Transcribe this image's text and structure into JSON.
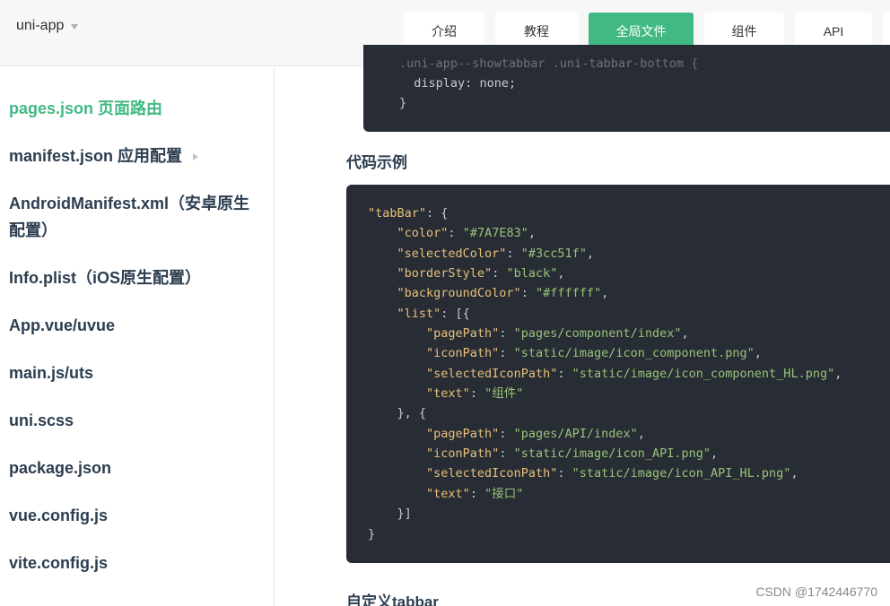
{
  "header": {
    "brand": "uni-app",
    "tabs": [
      {
        "label": "介绍",
        "active": false
      },
      {
        "label": "教程",
        "active": false
      },
      {
        "label": "全局文件",
        "active": true
      },
      {
        "label": "组件",
        "active": false
      },
      {
        "label": "API",
        "active": false
      }
    ]
  },
  "sidebar": {
    "items": [
      {
        "label": "pages.json 页面路由",
        "active": true
      },
      {
        "label": "manifest.json 应用配置",
        "expandable": true
      },
      {
        "label": "AndroidManifest.xml（安卓原生配置）"
      },
      {
        "label": "Info.plist（iOS原生配置）"
      },
      {
        "label": "App.vue/uvue"
      },
      {
        "label": "main.js/uts"
      },
      {
        "label": "uni.scss"
      },
      {
        "label": "package.json"
      },
      {
        "label": "vue.config.js"
      },
      {
        "label": "vite.config.js"
      }
    ]
  },
  "main": {
    "top_code": {
      "partial_line": ".uni-app--showtabbar .uni-tabbar-bottom {",
      "prop": "display",
      "value": "none",
      "close": "}"
    },
    "example_heading": "代码示例",
    "example_code": {
      "tabBar_key": "\"tabBar\"",
      "color_key": "\"color\"",
      "color_val": "\"#7A7E83\"",
      "selectedColor_key": "\"selectedColor\"",
      "selectedColor_val": "\"#3cc51f\"",
      "borderStyle_key": "\"borderStyle\"",
      "borderStyle_val": "\"black\"",
      "backgroundColor_key": "\"backgroundColor\"",
      "backgroundColor_val": "\"#ffffff\"",
      "list_key": "\"list\"",
      "item1": {
        "pagePath_key": "\"pagePath\"",
        "pagePath_val": "\"pages/component/index\"",
        "iconPath_key": "\"iconPath\"",
        "iconPath_val": "\"static/image/icon_component.png\"",
        "selectedIconPath_key": "\"selectedIconPath\"",
        "selectedIconPath_val": "\"static/image/icon_component_HL.png\"",
        "text_key": "\"text\"",
        "text_val": "\"组件\""
      },
      "item2": {
        "pagePath_key": "\"pagePath\"",
        "pagePath_val": "\"pages/API/index\"",
        "iconPath_key": "\"iconPath\"",
        "iconPath_val": "\"static/image/icon_API.png\"",
        "selectedIconPath_key": "\"selectedIconPath\"",
        "selectedIconPath_val": "\"static/image/icon_API_HL.png\"",
        "text_key": "\"text\"",
        "text_val": "\"接口\""
      }
    },
    "next_heading": "自定义tabbar"
  },
  "watermark": "CSDN @1742446770",
  "colors": {
    "accent": "#42b983",
    "code_bg": "#282c34",
    "code_key": "#e6c07b",
    "code_string": "#98c379"
  }
}
